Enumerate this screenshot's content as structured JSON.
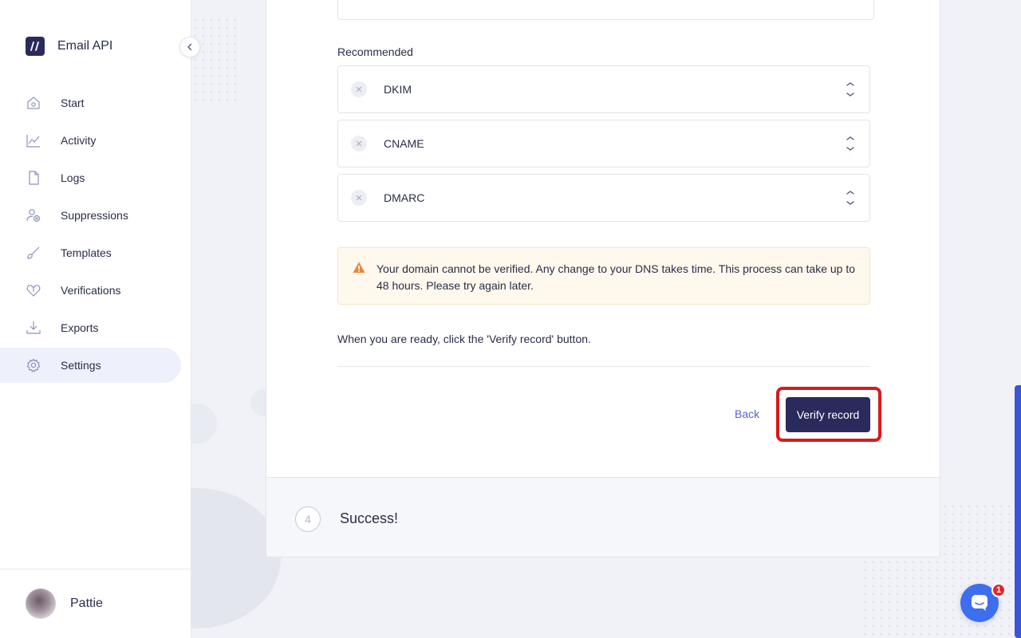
{
  "brand": {
    "name": "Email API"
  },
  "sidebar": {
    "items": [
      {
        "label": "Start",
        "icon": "home-icon"
      },
      {
        "label": "Activity",
        "icon": "chart-icon"
      },
      {
        "label": "Logs",
        "icon": "file-icon"
      },
      {
        "label": "Suppressions",
        "icon": "user-block-icon"
      },
      {
        "label": "Templates",
        "icon": "brush-icon"
      },
      {
        "label": "Verifications",
        "icon": "heart-icon"
      },
      {
        "label": "Exports",
        "icon": "download-icon"
      },
      {
        "label": "Settings",
        "icon": "gear-icon",
        "active": true
      }
    ]
  },
  "user": {
    "name": "Pattie"
  },
  "main": {
    "recommended_label": "Recommended",
    "records": [
      {
        "label": "DKIM"
      },
      {
        "label": "CNAME"
      },
      {
        "label": "DMARC"
      }
    ],
    "alert_text": "Your domain cannot be verified. Any change to your DNS takes time. This process can take up to 48 hours. Please try again later.",
    "ready_text": "When you are ready, click the 'Verify record' button.",
    "back_label": "Back",
    "verify_label": "Verify record"
  },
  "step4": {
    "number": "4",
    "title": "Success!"
  },
  "chat": {
    "badge": "1"
  },
  "colors": {
    "primary": "#2b2a5c",
    "accent": "#5a5fd6",
    "warning": "#e8863a",
    "highlight": "#d91a1a"
  }
}
